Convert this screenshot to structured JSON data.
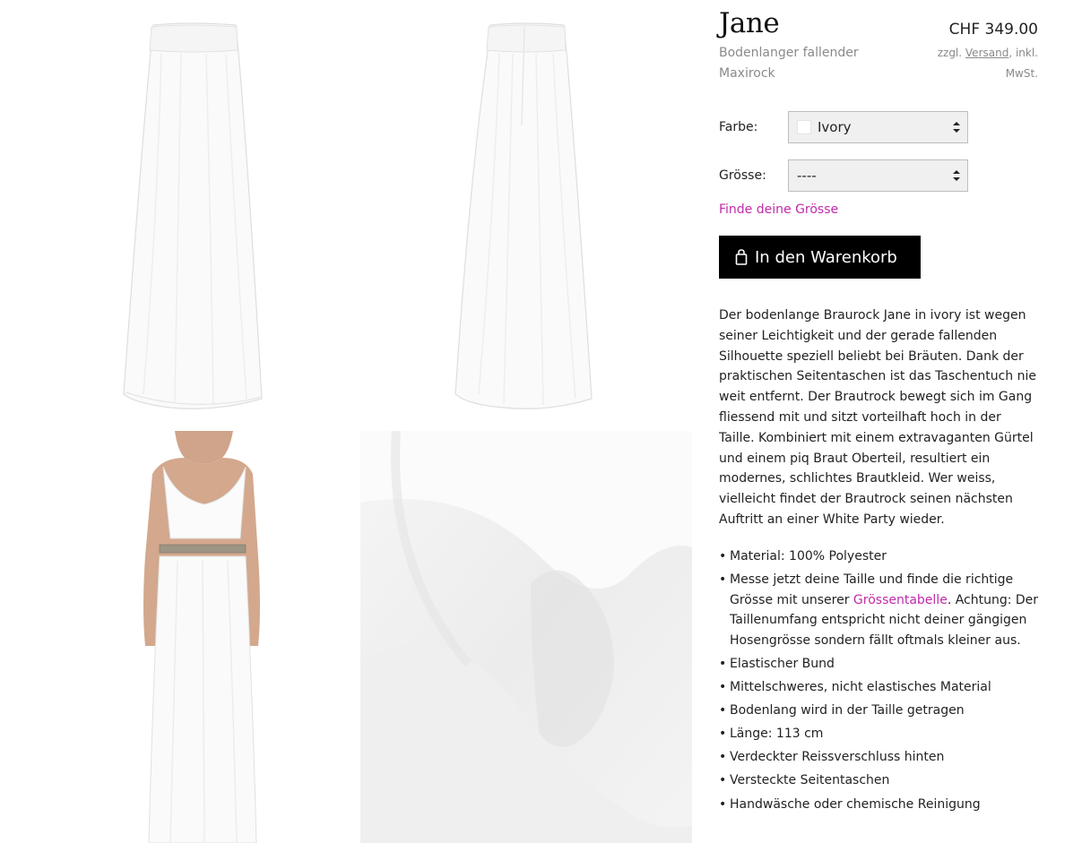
{
  "gallery": {
    "images": [
      {
        "name": "skirt-front-image"
      },
      {
        "name": "skirt-back-image"
      },
      {
        "name": "model-wearing-skirt-image"
      },
      {
        "name": "fabric-closeup-image"
      }
    ]
  },
  "product": {
    "title": "Jane",
    "subtitle": "Bodenlanger fallender Maxirock",
    "price": "CHF 349.00",
    "tax_prefix": "zzgl. ",
    "tax_link": "Versand",
    "tax_suffix": ", inkl. MwSt."
  },
  "options": {
    "color_label": "Farbe:",
    "color_value": "Ivory",
    "color_swatch": "#ffffff",
    "size_label": "Grösse:",
    "size_value": "----",
    "find_size": "Finde deine Grösse"
  },
  "cart": {
    "button_label": "In den Warenkorb"
  },
  "description": "Der bodenlange Braurock Jane in ivory ist wegen seiner Leichtigkeit und der gerade fallenden Silhouette speziell beliebt bei Bräuten. Dank der praktischen Seitentaschen ist das Taschentuch nie weit entfernt. Der Brautrock bewegt sich im Gang fliessend mit und sitzt vorteilhaft hoch in der Taille. Kombiniert mit einem extravaganten Gürtel und einem piq Braut Oberteil, resultiert ein modernes, schlichtes Brautkleid. Wer weiss, vielleicht findet der Brautrock seinen nächsten Auftritt an einer White Party wieder.",
  "features": {
    "bullet": "•",
    "material": "Material: 100% Polyester",
    "measure_pre": "Messe jetzt deine Taille und finde die richtige Grösse mit unserer ",
    "measure_link": "Grössentabelle",
    "measure_post": ". Achtung: Der Taillenumfang entspricht nicht deiner gängigen Hosengrösse sondern fällt oftmals kleiner aus.",
    "items": [
      "Elastischer Bund",
      "Mittelschweres, nicht elastisches Material",
      "Bodenlang wird in der Taille getragen",
      "Länge: 113 cm",
      "Verdeckter Reissverschluss hinten",
      "Versteckte Seitentaschen",
      "Handwäsche oder chemische Reinigung"
    ]
  },
  "colors": {
    "accent_pink": "#c02ba8",
    "button_bg": "#000000",
    "muted_text": "#8a8a8a"
  }
}
